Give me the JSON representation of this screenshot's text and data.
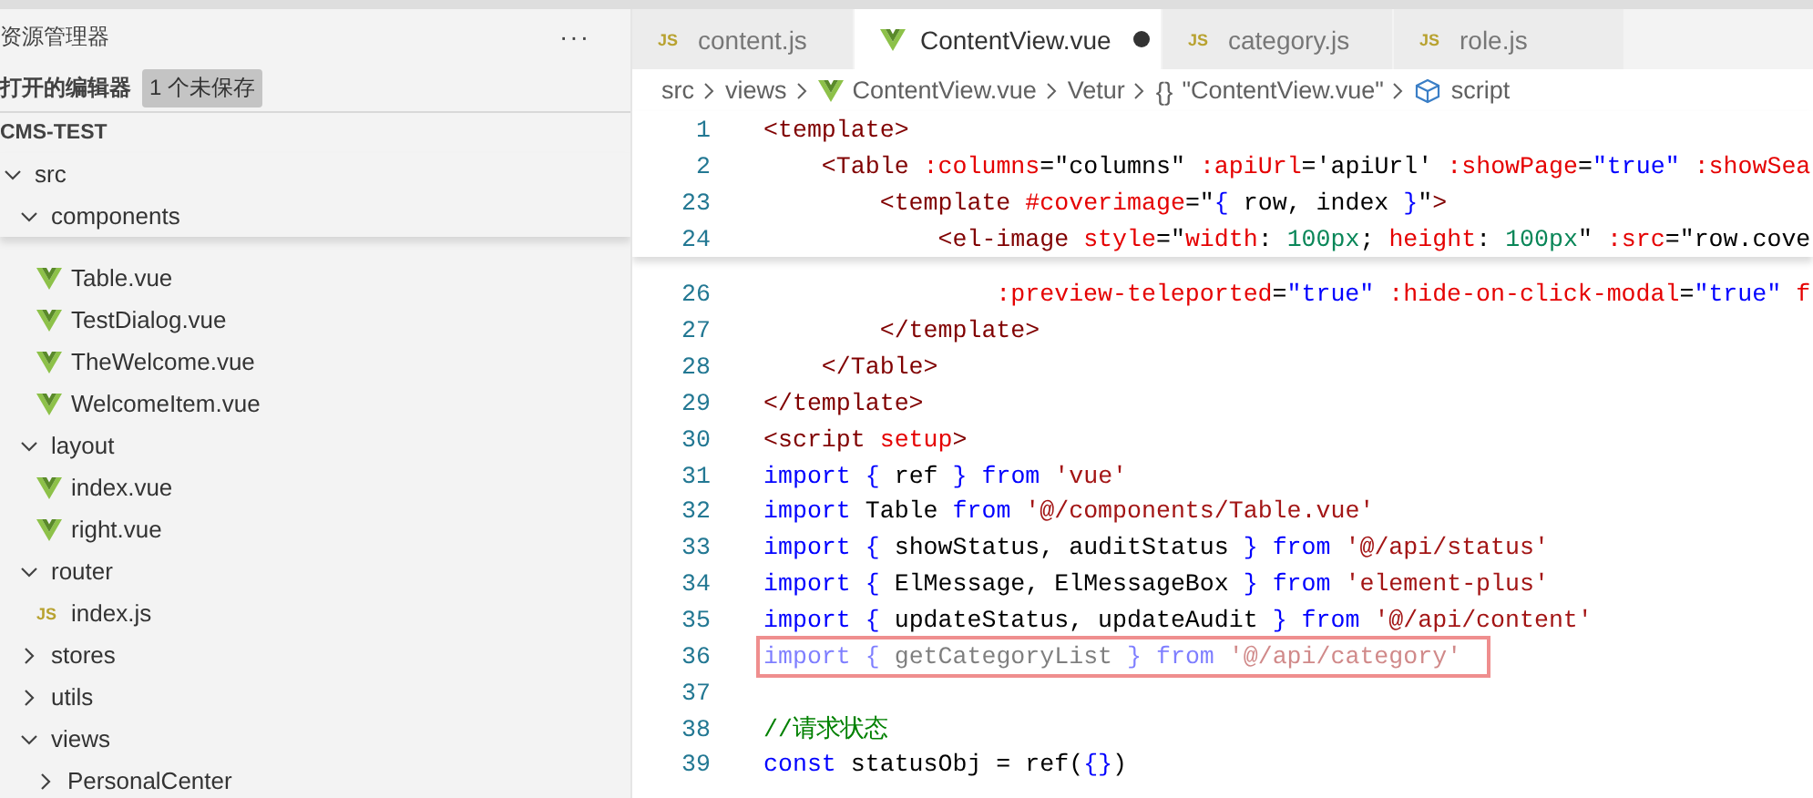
{
  "sidebar": {
    "title": "资源管理器",
    "more": "···",
    "open_editors": {
      "label": "打开的编辑器",
      "badge": "1 个未保存"
    },
    "project": "CMS-TEST",
    "tree": [
      {
        "name": "src",
        "expanded": true,
        "children": [
          {
            "name": "components",
            "expanded": true,
            "children": [
              {
                "name": "Table.vue",
                "kind": "vue"
              },
              {
                "name": "TestDialog.vue",
                "kind": "vue"
              },
              {
                "name": "TheWelcome.vue",
                "kind": "vue"
              },
              {
                "name": "WelcomeItem.vue",
                "kind": "vue"
              }
            ]
          },
          {
            "name": "layout",
            "expanded": true,
            "children": [
              {
                "name": "index.vue",
                "kind": "vue"
              },
              {
                "name": "right.vue",
                "kind": "vue"
              }
            ]
          },
          {
            "name": "router",
            "expanded": true,
            "children": [
              {
                "name": "index.js",
                "kind": "js",
                "icon_label": "JS"
              }
            ]
          },
          {
            "name": "stores",
            "expanded": false
          },
          {
            "name": "utils",
            "expanded": false
          },
          {
            "name": "views",
            "expanded": true,
            "children": [
              {
                "name": "PersonalCenter",
                "expanded": false
              }
            ]
          }
        ]
      }
    ]
  },
  "tabs": [
    {
      "label": "content.js",
      "kind": "js",
      "icon_label": "JS",
      "selected": false,
      "modified": false
    },
    {
      "label": "ContentView.vue",
      "kind": "vue",
      "selected": true,
      "modified": true
    },
    {
      "label": "category.js",
      "kind": "js",
      "icon_label": "JS",
      "selected": false,
      "modified": false
    },
    {
      "label": "role.js",
      "kind": "js",
      "icon_label": "JS",
      "selected": false,
      "modified": false
    }
  ],
  "breadcrumb": [
    {
      "label": "src",
      "kind": "folder"
    },
    {
      "label": "views",
      "kind": "folder"
    },
    {
      "label": "ContentView.vue",
      "kind": "vue"
    },
    {
      "label": "Vetur",
      "kind": "folder"
    },
    {
      "label": "\"ContentView.vue\"",
      "kind": "object",
      "icon_label": "{}"
    },
    {
      "label": "script",
      "kind": "element"
    }
  ],
  "editor": {
    "sticky_lines": [
      {
        "number": "1",
        "kind": "markup",
        "text": "<template>"
      },
      {
        "number": "2",
        "kind": "markup",
        "text": "    <Table :columns=\"columns\" :apiUrl='apiUrl' :showPage=\"true\" :showSea"
      },
      {
        "number": "23",
        "kind": "markup",
        "text": "        <template #coverimage=\"{ row, index }\">"
      },
      {
        "number": "24",
        "kind": "markup",
        "text": "            <el-image style=\"width: 100px; height: 100px\" :src=\"row.cove"
      }
    ],
    "lines": [
      {
        "number": "26",
        "kind": "markup",
        "text": "                :preview-teleported=\"true\" :hide-on-click-modal=\"true\" f"
      },
      {
        "number": "27",
        "kind": "markup",
        "text": "        </template>"
      },
      {
        "number": "28",
        "kind": "markup",
        "text": "    </Table>"
      },
      {
        "number": "29",
        "kind": "markup",
        "text": "</template>"
      },
      {
        "number": "30",
        "kind": "markup",
        "text": "<script setup>"
      },
      {
        "number": "31",
        "kind": "script",
        "text": "import { ref } from 'vue'"
      },
      {
        "number": "32",
        "kind": "script",
        "text": "import Table from '@/components/Table.vue'"
      },
      {
        "number": "33",
        "kind": "script",
        "text": "import { showStatus, auditStatus } from '@/api/status'"
      },
      {
        "number": "34",
        "kind": "script",
        "text": "import { ElMessage, ElMessageBox } from 'element-plus'"
      },
      {
        "number": "35",
        "kind": "script",
        "text": "import { updateStatus, updateAudit } from '@/api/content'"
      },
      {
        "number": "36",
        "kind": "script",
        "unused": true,
        "highlighted": true,
        "text": "import { getCategoryList } from '@/api/category'"
      },
      {
        "number": "37",
        "kind": "blank"
      },
      {
        "number": "38",
        "kind": "comment",
        "text": "//请求状态"
      },
      {
        "number": "39",
        "kind": "script",
        "text": "const statusObj = ref({})"
      }
    ]
  }
}
